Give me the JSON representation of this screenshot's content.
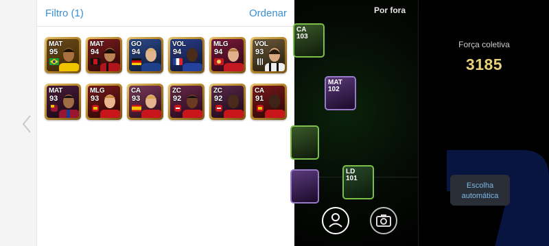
{
  "header": {
    "filter_label": "Filtro (1)",
    "sort_label": "Ordenar"
  },
  "players": [
    {
      "pos": "MAT",
      "rating": "95",
      "badge": "brazil-flag",
      "kit": "#f0c400"
    },
    {
      "pos": "MAT",
      "rating": "94",
      "badge": "milan-crest",
      "kit": "#b0141c"
    },
    {
      "pos": "GO",
      "rating": "94",
      "badge": "germany-flag",
      "kit": "#1f3f8a"
    },
    {
      "pos": "VOL",
      "rating": "94",
      "badge": "france-flag",
      "kit": "#23409a"
    },
    {
      "pos": "MLG",
      "rating": "94",
      "badge": "liverpool-crest",
      "kit": "#c21a20"
    },
    {
      "pos": "VOL",
      "rating": "93",
      "badge": "juventus-crest",
      "kit": "#1a1a1a"
    },
    {
      "pos": "MAT",
      "rating": "93",
      "badge": "barcelona-crest",
      "kit": "#9b1530"
    },
    {
      "pos": "MLG",
      "rating": "93",
      "badge": "manutd-crest",
      "kit": "#c8151b"
    },
    {
      "pos": "CA",
      "rating": "93",
      "badge": "spain-flag",
      "kit": "#c8151b"
    },
    {
      "pos": "ZC",
      "rating": "92",
      "badge": "arsenal-crest",
      "kit": "#c8151b"
    },
    {
      "pos": "ZC",
      "rating": "92",
      "badge": "arsenal-crest",
      "kit": "#c8151b"
    },
    {
      "pos": "CA",
      "rating": "91",
      "badge": "manutd-crest",
      "kit": "#c8151b"
    }
  ],
  "field": {
    "por_fora_label": "Por fora",
    "cards": [
      {
        "pos": "CA",
        "rating": "103"
      },
      {
        "pos": "MAT",
        "rating": "102"
      },
      {
        "pos": "",
        "rating": ""
      },
      {
        "pos": "LD",
        "rating": "101"
      },
      {
        "pos": "",
        "rating": ""
      }
    ],
    "buttons": [
      "person-icon",
      "camera-icon"
    ]
  },
  "team": {
    "strength_label": "Força coletiva",
    "strength_value": "3185",
    "auto_select_label": "Escolha automática"
  },
  "colors": {
    "accent": "#3a8fd3",
    "strength": "#e8cf7a",
    "card_gold": "#c9973a"
  }
}
